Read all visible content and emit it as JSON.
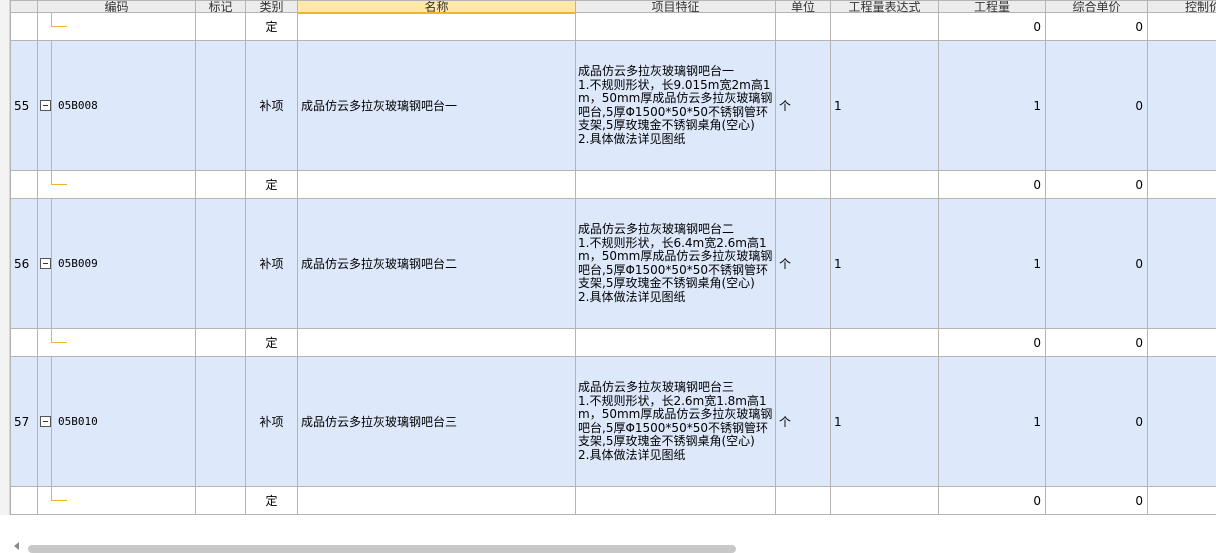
{
  "columns": {
    "seq": "",
    "code": "编码",
    "mark": "标记",
    "category": "类别",
    "name": "名称",
    "feature": "项目特征",
    "unit": "单位",
    "expr": "工程量表达式",
    "qty": "工程量",
    "price": "综合单价",
    "ctrl": "控制价"
  },
  "top_ding": {
    "category": "定",
    "qty": "0",
    "price": "0"
  },
  "rows": [
    {
      "seq": "55",
      "code": "05B008",
      "category": "补项",
      "name": "成品仿云多拉灰玻璃钢吧台一",
      "feature": "成品仿云多拉灰玻璃钢吧台一\n1.不规则形状，长9.015m宽2m高1m，50mm厚成品仿云多拉灰玻璃钢吧台,5厚Φ1500*50*50不锈钢管环支架,5厚玫瑰金不锈钢桌角(空心)\n2.具体做法详见图纸",
      "unit": "个",
      "expr": "1",
      "qty": "1",
      "price": "0",
      "ding": {
        "category": "定",
        "qty": "0",
        "price": "0"
      }
    },
    {
      "seq": "56",
      "code": "05B009",
      "category": "补项",
      "name": "成品仿云多拉灰玻璃钢吧台二",
      "feature": "成品仿云多拉灰玻璃钢吧台二\n1.不规则形状，长6.4m宽2.6m高1m，50mm厚成品仿云多拉灰玻璃钢吧台,5厚Φ1500*50*50不锈钢管环支架,5厚玫瑰金不锈钢桌角(空心)\n2.具体做法详见图纸",
      "unit": "个",
      "expr": "1",
      "qty": "1",
      "price": "0",
      "ding": {
        "category": "定",
        "qty": "0",
        "price": "0"
      }
    },
    {
      "seq": "57",
      "code": "05B010",
      "category": "补项",
      "name": "成品仿云多拉灰玻璃钢吧台三",
      "feature": "成品仿云多拉灰玻璃钢吧台三\n1.不规则形状，长2.6m宽1.8m高1m，50mm厚成品仿云多拉灰玻璃钢吧台,5厚Φ1500*50*50不锈钢管环支架,5厚玫瑰金不锈钢桌角(空心)\n2.具体做法详见图纸",
      "unit": "个",
      "expr": "1",
      "qty": "1",
      "price": "0",
      "ding": {
        "category": "定",
        "qty": "0",
        "price": "0"
      }
    }
  ]
}
